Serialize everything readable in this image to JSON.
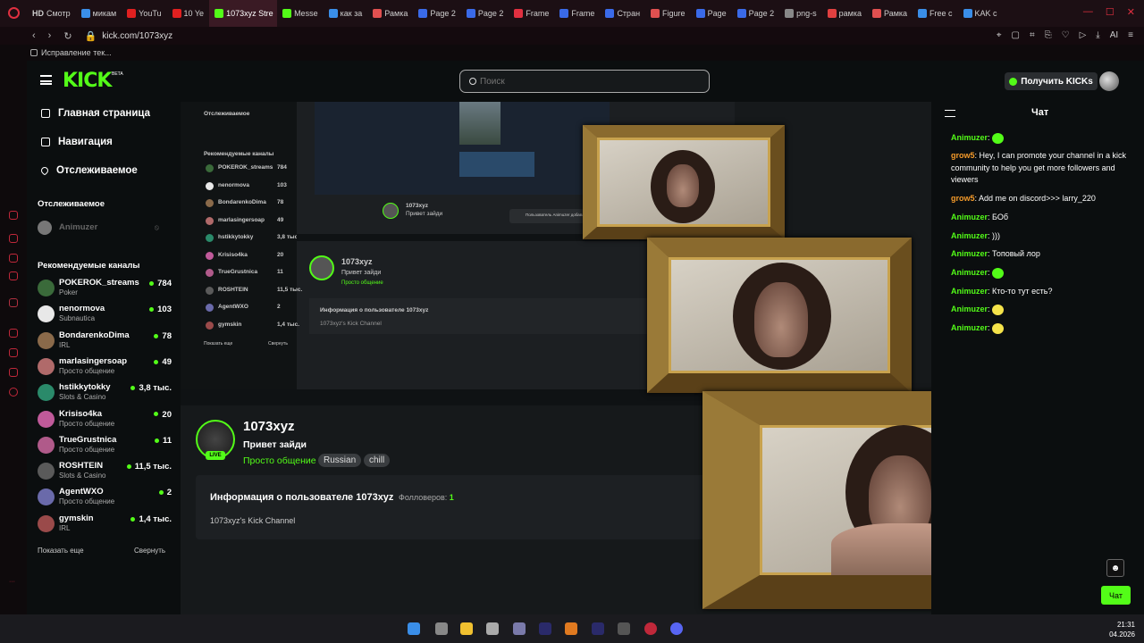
{
  "browser": {
    "tabs": [
      "",
      "Смотр",
      "микам",
      "YouTu",
      "10 Ye",
      "1073xyz Stre",
      "Messe",
      "как за",
      "Рамка",
      "Page 2",
      "Page 2",
      "Frame",
      "Frame",
      "Стран",
      "Figure",
      "Page",
      "Page 2",
      "png-s",
      "рамка",
      "Рамка",
      "Free c",
      "KAK с"
    ],
    "tab_prefix_hd": "HD",
    "url": "kick.com/1073xyz",
    "bookmark": "Исправление тек...",
    "right_label": "AI"
  },
  "header": {
    "logo": "KICK",
    "logo_beta": "BETA",
    "search_placeholder": "Поиск",
    "kicks_button": "Получить KICKs"
  },
  "sidebar": {
    "nav": [
      {
        "label": "Главная страница",
        "icon": "home-icon"
      },
      {
        "label": "Навигация",
        "icon": "browse-icon"
      },
      {
        "label": "Отслеживаемое",
        "icon": "heart-icon"
      }
    ],
    "following_title": "Отслеживаемое",
    "following_user": "Animuzer",
    "recommended_title": "Рекомендуемые каналы",
    "channels": [
      {
        "name": "POKEROK_streams",
        "category": "Poker",
        "viewers": "784",
        "color": "#3a6a3a"
      },
      {
        "name": "nenormova",
        "category": "Subnautica",
        "viewers": "103",
        "color": "#e8e8e8"
      },
      {
        "name": "BondarenkoDima",
        "category": "IRL",
        "viewers": "78",
        "color": "#8a6a4a"
      },
      {
        "name": "marlasingersoap",
        "category": "Просто общение",
        "viewers": "49",
        "color": "#b06a6a"
      },
      {
        "name": "hstikkytokky",
        "category": "Slots & Casino",
        "viewers": "3,8 тыс.",
        "color": "#2a8a6a"
      },
      {
        "name": "Krisiso4ka",
        "category": "Просто общение",
        "viewers": "20",
        "color": "#c05a9a"
      },
      {
        "name": "TrueGrustnica",
        "category": "Просто общение",
        "viewers": "11",
        "color": "#b05a8a"
      },
      {
        "name": "ROSHTEIN",
        "category": "Slots & Casino",
        "viewers": "11,5 тыс.",
        "color": "#5a5a5a"
      },
      {
        "name": "AgentWXO",
        "category": "Просто общение",
        "viewers": "2",
        "color": "#6a6aaa"
      },
      {
        "name": "gymskin",
        "category": "IRL",
        "viewers": "1,4 тыс.",
        "color": "#9a4a4a"
      }
    ],
    "show_more": "Показать еще",
    "collapse": "Свернуть"
  },
  "channel": {
    "name": "1073xyz",
    "title": "Привет зайди",
    "category": "Просто общение",
    "tags": [
      "Russian",
      "chill"
    ],
    "live": "LIVE",
    "about_title": "Информация о пользователе 1073xyz",
    "followers_label": "Фолловеров:",
    "followers_count": "1",
    "description": "1073xyz's Kick Channel"
  },
  "nested": {
    "notice": "Пользователь Animuzer добавлен в ваш список в роли moderator",
    "show_more": "Показать еще",
    "collapse": "Свернуть"
  },
  "chat": {
    "title": "Чат",
    "messages": [
      {
        "user": "Animuzer",
        "color": "#53fc18",
        "text": "",
        "emote": "green"
      },
      {
        "user": "grow5",
        "color": "#f59b2a",
        "text": "Hey, I can promote your channel in a kick community to help you get more followers and viewers",
        "emote": ""
      },
      {
        "user": "grow5",
        "color": "#f59b2a",
        "text": "Add me on discord>>> larry_220",
        "emote": ""
      },
      {
        "user": "Animuzer",
        "color": "#53fc18",
        "text": "БОб",
        "emote": ""
      },
      {
        "user": "Animuzer",
        "color": "#53fc18",
        "text": ")))",
        "emote": ""
      },
      {
        "user": "Animuzer",
        "color": "#53fc18",
        "text": "Топовый лор",
        "emote": ""
      },
      {
        "user": "Animuzer",
        "color": "#53fc18",
        "text": "",
        "emote": "green"
      },
      {
        "user": "Animuzer",
        "color": "#53fc18",
        "text": "Кто-то тут есть?",
        "emote": ""
      },
      {
        "user": "Animuzer",
        "color": "#53fc18",
        "text": "",
        "emote": "yellow"
      },
      {
        "user": "Animuzer",
        "color": "#53fc18",
        "text": "",
        "emote": "yellow"
      }
    ],
    "chat_button": "Чат"
  },
  "taskbar": {
    "time": "21:31",
    "date": "04.2026"
  }
}
